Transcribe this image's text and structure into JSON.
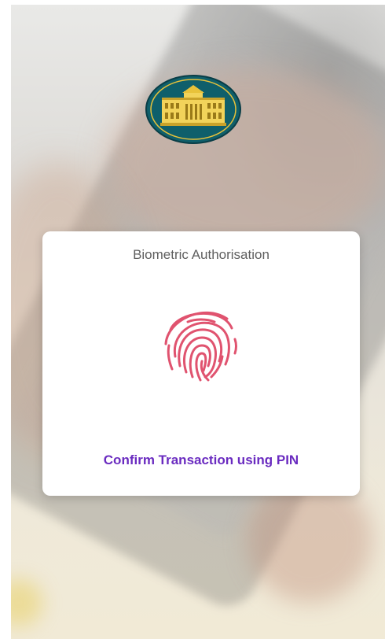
{
  "dialog": {
    "title": "Biometric Authorisation",
    "fingerprint_icon": "fingerprint-icon",
    "confirm_pin_label": "Confirm Transaction using PIN"
  },
  "logo": {
    "icon": "bank-building-logo"
  },
  "colors": {
    "accent": "#6a2bc0",
    "fingerprint": "#e0536f",
    "logo_teal": "#0f5f6b",
    "logo_gold": "#e8c23a"
  }
}
